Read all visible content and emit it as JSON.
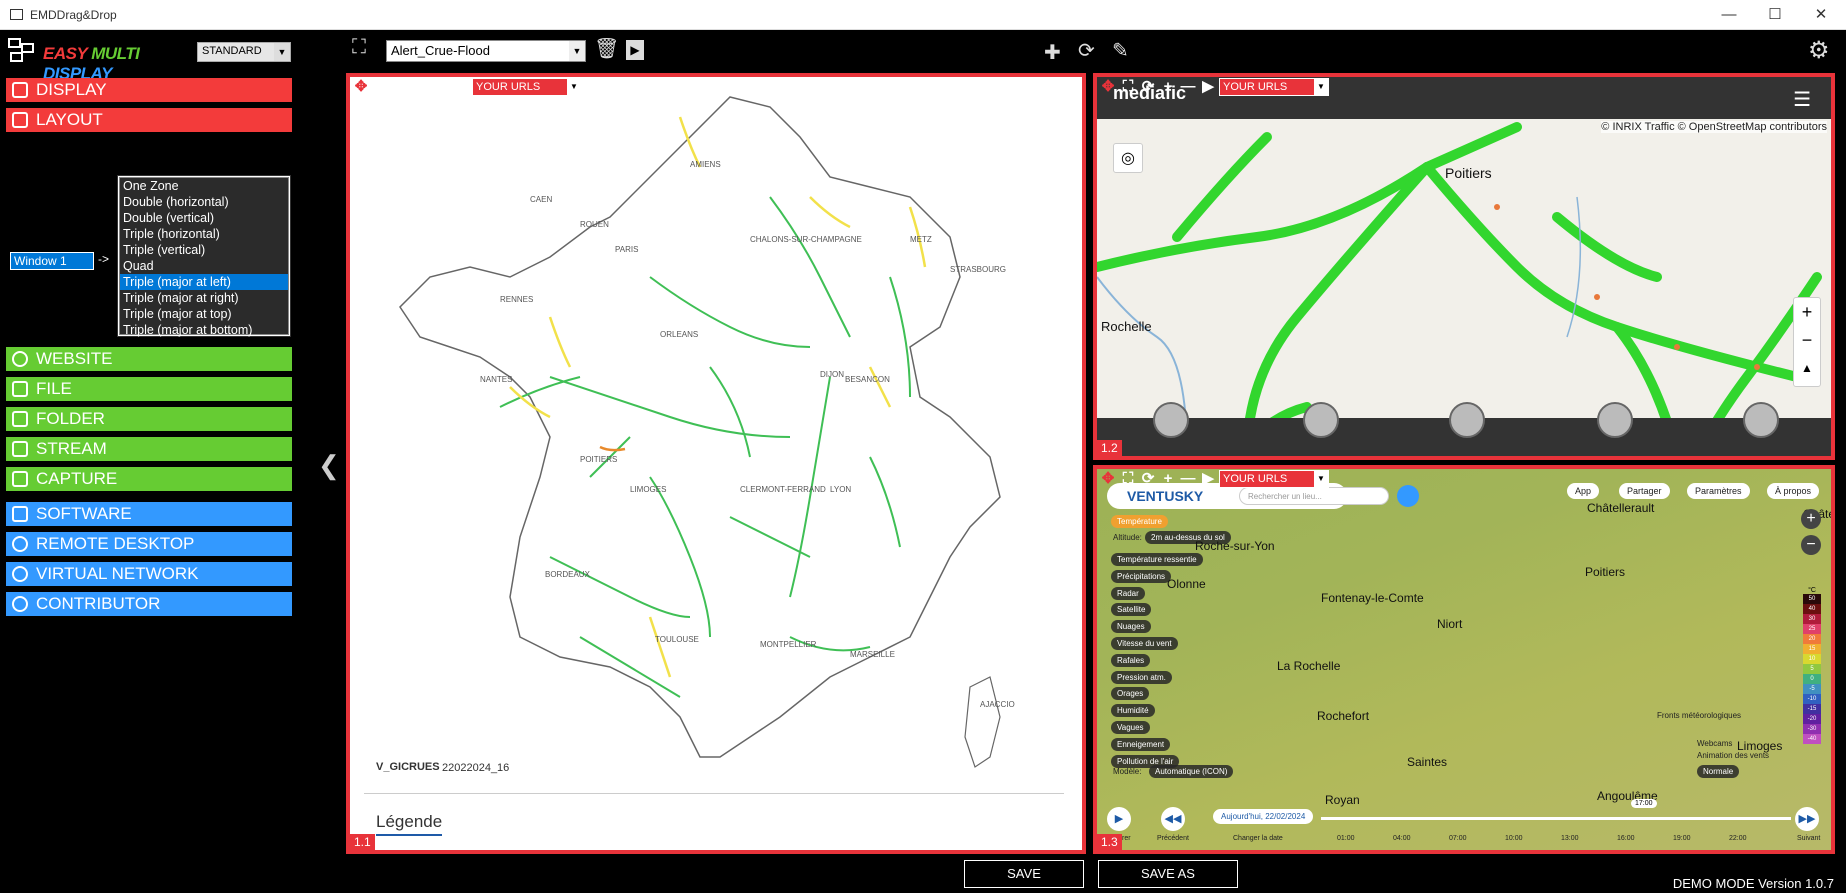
{
  "window": {
    "title": "EMDDrag&Drop"
  },
  "app": {
    "logo_text": "EASY MULTI DISPLAY",
    "mode": "STANDARD",
    "status": "DEMO MODE  Version  1.0.7"
  },
  "menu": {
    "display": "DISPLAY",
    "layout": "LAYOUT",
    "website": "WEBSITE",
    "file": "FILE",
    "folder": "FOLDER",
    "stream": "STREAM",
    "capture": "CAPTURE",
    "software": "SOFTWARE",
    "remote_desktop": "REMOTE DESKTOP",
    "virtual_network": "VIRTUAL NETWORK",
    "contributor": "CONTRIBUTOR"
  },
  "layout_options": [
    "One Zone",
    "Double (horizontal)",
    "Double (vertical)",
    "Triple (horizontal)",
    "Triple (vertical)",
    "Quad",
    "Triple (major at left)",
    "Triple (major at right)",
    "Triple (major at top)",
    "Triple (major at bottom)"
  ],
  "selected_layout": "Triple (major at left)",
  "window_field": "Window 1",
  "arrow": "->",
  "preset": "Alert_Crue-Flood",
  "zones": {
    "z11": {
      "label": "1.1",
      "url": "YOUR URLS"
    },
    "z12": {
      "label": "1.2",
      "url": "YOUR URLS"
    },
    "z13": {
      "label": "1.3",
      "url": "YOUR URLS"
    }
  },
  "vigicrues": {
    "brand": "V_GICRUES",
    "code": "22022024_16",
    "legend": "Légende"
  },
  "traffic": {
    "attribution": "© INRIX Traffic © OpenStreetMap contributors",
    "cities": [
      "Poitiers",
      "Rochelle"
    ],
    "brand": "mediafic"
  },
  "ventusky": {
    "brand": "VENTUSKY",
    "search_placeholder": "Rechercher un lieu...",
    "buttons": [
      "App",
      "Partager",
      "Paramètres",
      "À propos"
    ],
    "layers": [
      "Température",
      "Température ressentie",
      "Précipitations",
      "Radar",
      "Satellite",
      "Nuages",
      "Vitesse du vent",
      "Rafales",
      "Pression atm.",
      "Orages",
      "Humidité",
      "Vagues",
      "Enneigement",
      "Pollution de l'air"
    ],
    "altitude_label": "Altitude:",
    "altitude_value": "2m au-dessus du sol",
    "model_label": "Modèle:",
    "model_value": "Automatique (ICON)",
    "cities": [
      "Châtellerault",
      "Poitiers",
      "Fontenay-le-Comte",
      "Niort",
      "La Rochelle",
      "Rochefort",
      "Saintes",
      "Angoulême",
      "Royan",
      "Limoges",
      "Roche-sur-Yon",
      "Olonne",
      "Châte"
    ],
    "date_button": "Aujourd'hui, 22/02/2024",
    "time_marker": "17:00",
    "times": [
      "01:00",
      "04:00",
      "07:00",
      "10:00",
      "13:00",
      "16:00",
      "19:00",
      "22:00"
    ],
    "controls": [
      "Démarrer",
      "Précédent",
      "Changer la date",
      "Suivant"
    ],
    "fronts": "Fronts météorologiques",
    "webcams": "Webcams",
    "anim": "Animation des vents",
    "anim_value": "Normale",
    "scale_unit": "°C",
    "scale": [
      "50",
      "40",
      "30",
      "25",
      "20",
      "15",
      "10",
      "5",
      "0",
      "-5",
      "-10",
      "-15",
      "-20",
      "-30",
      "-40"
    ]
  },
  "buttons": {
    "save": "SAVE",
    "save_as": "SAVE AS"
  },
  "colors": {
    "red": "#f33b3b",
    "green": "#66cc33",
    "blue": "#3399ff",
    "zone_border": "#e8333a",
    "selection": "#0078d7"
  }
}
